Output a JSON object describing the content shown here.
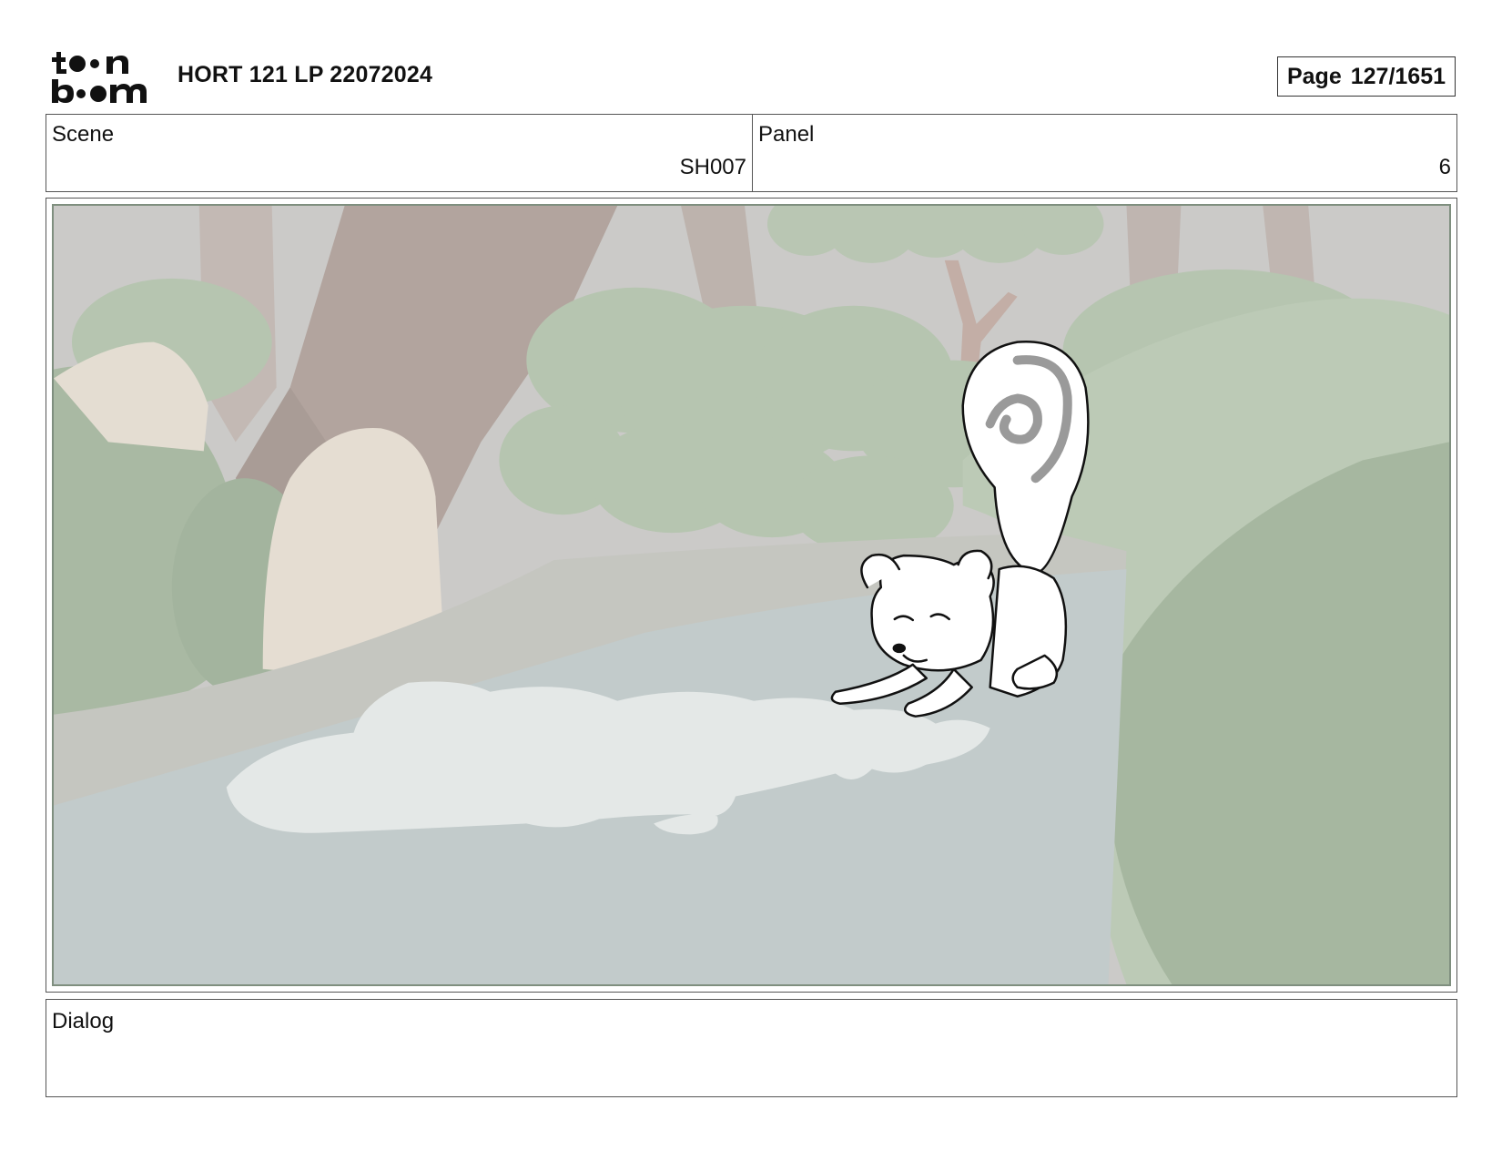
{
  "header": {
    "logo_text_top": "toon",
    "logo_text_bottom": "boom",
    "project_title": "HORT 121 LP 22072024",
    "page_label": "Page",
    "page_value": "127/1651"
  },
  "info": {
    "scene_label": "Scene",
    "scene_value": "SH007",
    "panel_label": "Panel",
    "panel_value": "6"
  },
  "dialog": {
    "label": "Dialog",
    "text": ""
  },
  "colors": {
    "background_tint": "#c9cac6",
    "water": "#c4cdcd",
    "foliage": "#b3c4ae",
    "trunk": "#a59a93",
    "rock": "#e6e0d6"
  }
}
